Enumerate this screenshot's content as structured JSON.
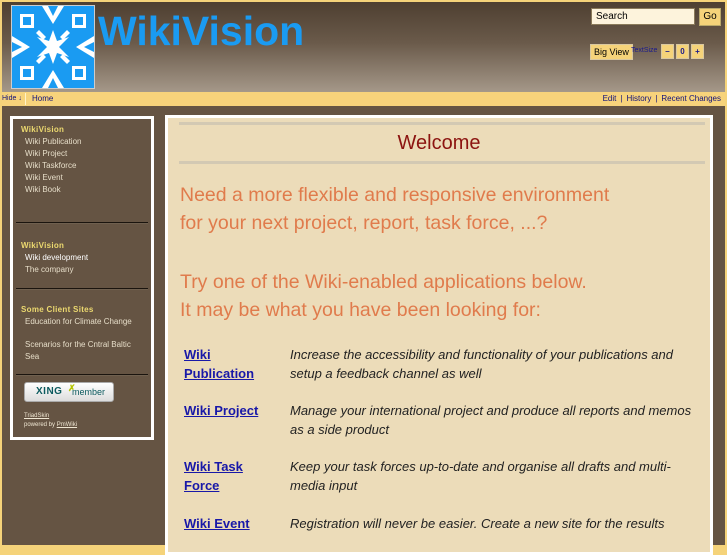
{
  "header": {
    "site_title": "WikiVision",
    "logo": "wikivision-snowflake-logo",
    "search": {
      "value": "Search",
      "go_label": "Go"
    },
    "big_view_label": "Big View",
    "textsize_label": "TextSize",
    "textsize_buttons": [
      "–",
      "0",
      "+"
    ]
  },
  "navbar": {
    "hide_label": "Hide ↓",
    "home_label": "Home",
    "actions": [
      "Edit",
      "History",
      "Recent Changes"
    ],
    "separator": "|"
  },
  "sidebar": {
    "sections": [
      {
        "heading": "WikiVision",
        "items": [
          "Wiki Publication",
          "Wiki Project",
          "Wiki Taskforce",
          "Wiki Event",
          "Wiki Book"
        ]
      },
      {
        "heading": "WikiVision",
        "items": [
          "Wiki development",
          "The company"
        ]
      },
      {
        "heading": "Some Client Sites",
        "items": [
          "Education for Climate Change",
          "Scenarios for the Cntral Baltic Sea"
        ]
      }
    ],
    "xing_badge": {
      "brand": "XING",
      "label": "member"
    },
    "skin_link": "TriadSkin",
    "powered_by": "powered by",
    "pmwiki_link": "PmWiki"
  },
  "content": {
    "title": "Welcome",
    "lead1_line1": "Need a more flexible and responsive environment",
    "lead1_line2": "for your next project, report, task force, ...?",
    "lead2_line1": "Try one of the Wiki-enabled applications below.",
    "lead2_line2": "It may be what you have been looking for:",
    "apps": [
      {
        "name_line1": "Wiki",
        "name_line2": "Publication",
        "desc_line1": "Increase the accessibility and functionality of your publications and",
        "desc_line2": "setup a feedback channel as well"
      },
      {
        "name_line1": "Wiki Project",
        "name_line2": "",
        "desc_line1": "Manage your international project and produce all reports and memos",
        "desc_line2": "as a side product"
      },
      {
        "name_line1": "Wiki Task",
        "name_line2": "Force",
        "desc_line1": "Keep your task forces up-to-date and organise all drafts and multi-",
        "desc_line2": "media input"
      },
      {
        "name_line1": "Wiki Event",
        "name_line2": "",
        "desc_line1": "Registration will never be easier. Create a new site for the results",
        "desc_line2": ""
      }
    ]
  },
  "colors": {
    "brand_blue": "#1a9bf2",
    "title_red": "#8c1410",
    "lead_orange": "#e07b4c",
    "link_blue": "#1818a8",
    "sidebar_brown": "#655443",
    "accent_yellow": "#f5d37a"
  }
}
